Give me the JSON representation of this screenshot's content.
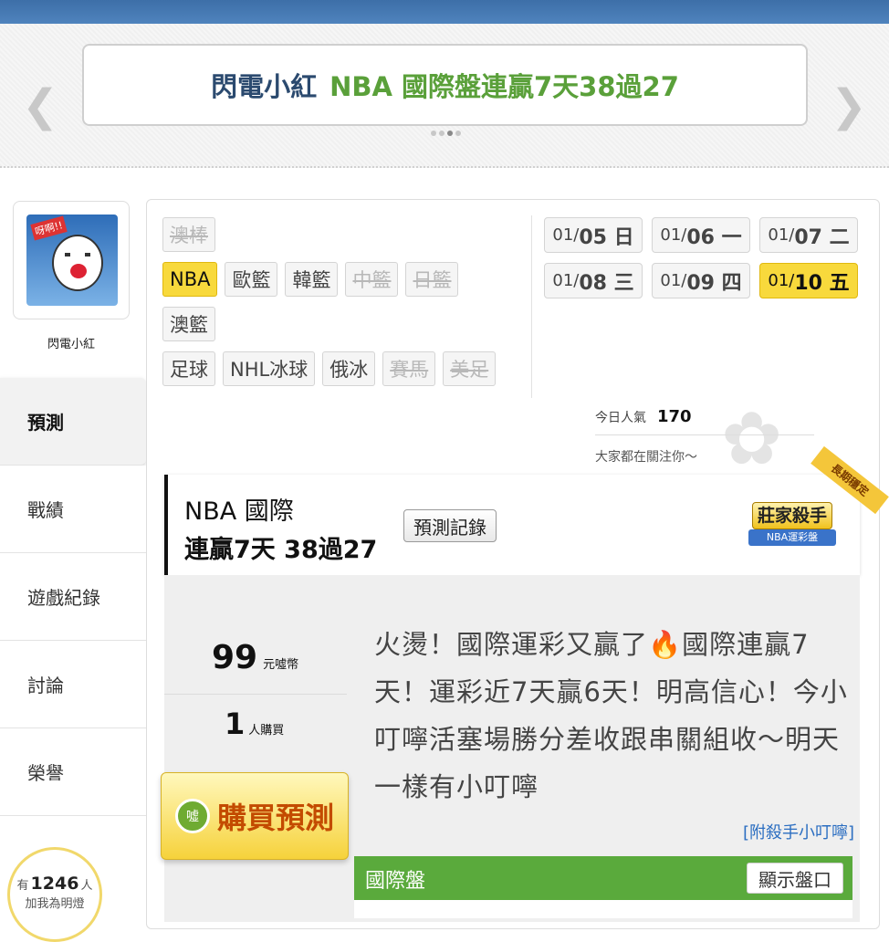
{
  "banner": {
    "name": "閃電小紅",
    "headline": "NBA 國際盤連贏7天38過27",
    "prev_icon": "chevron-left-icon",
    "next_icon": "chevron-right-icon",
    "active_dot": 2
  },
  "profile": {
    "name": "閃電小紅",
    "avatar_sign": "呀啊!!"
  },
  "nav": {
    "items": [
      {
        "label": "預測"
      },
      {
        "label": "戰績"
      },
      {
        "label": "遊戲紀錄"
      },
      {
        "label": "討論"
      },
      {
        "label": "榮譽"
      }
    ]
  },
  "fans": {
    "prefix": "有",
    "count": "1246",
    "suffix": "人",
    "sub": "加我為明燈"
  },
  "tags": {
    "row1": [
      {
        "label": "澳棒",
        "state": "disabled"
      }
    ],
    "row2": [
      {
        "label": "NBA",
        "state": "active"
      },
      {
        "label": "歐籃",
        "state": "normal"
      },
      {
        "label": "韓籃",
        "state": "normal"
      },
      {
        "label": "中籃",
        "state": "disabled"
      },
      {
        "label": "日籃",
        "state": "disabled"
      }
    ],
    "row3": [
      {
        "label": "澳籃",
        "state": "normal"
      }
    ],
    "row4": [
      {
        "label": "足球",
        "state": "normal"
      },
      {
        "label": "NHL冰球",
        "state": "normal"
      },
      {
        "label": "俄冰",
        "state": "normal"
      },
      {
        "label": "賽馬",
        "state": "disabled"
      },
      {
        "label": "美足",
        "state": "disabled"
      }
    ]
  },
  "dates": [
    {
      "m": "01/",
      "d": "05 日"
    },
    {
      "m": "01/",
      "d": "06 一"
    },
    {
      "m": "01/",
      "d": "07 二"
    },
    {
      "m": "01/",
      "d": "08 三"
    },
    {
      "m": "01/",
      "d": "09 四"
    },
    {
      "m": "01/",
      "d": "10 五",
      "active": true
    }
  ],
  "popularity": {
    "label": "今日人氣",
    "value": "170",
    "sub": "大家都在關注你～"
  },
  "record": {
    "title": "NBA 國際",
    "sub": "連贏7天 38過27",
    "button": "預測記錄",
    "badge_top": "莊家殺手",
    "badge_bottom": "NBA運彩盤",
    "ribbon": "長期穩定"
  },
  "purchase": {
    "price": "99",
    "price_unit": "元噓幣",
    "buyers": "1",
    "buyers_unit": "人購買",
    "buy_label": "購買預測",
    "buy_icon_text": "噓"
  },
  "description": "火燙！國際運彩又贏了🔥國際連贏7天！運彩近7天贏6天！明高信心！今小叮嚀活塞場勝分差收跟串關組收～明天一樣有小叮嚀",
  "attachment_link": "[附殺手小叮嚀]",
  "market": {
    "title": "國際盤",
    "show_button": "顯示盤口"
  },
  "colors": {
    "accent_yellow": "#f8d93c",
    "green": "#5aaa3c",
    "link_blue": "#2b6ec1",
    "top_bar": "#4f83bd"
  }
}
